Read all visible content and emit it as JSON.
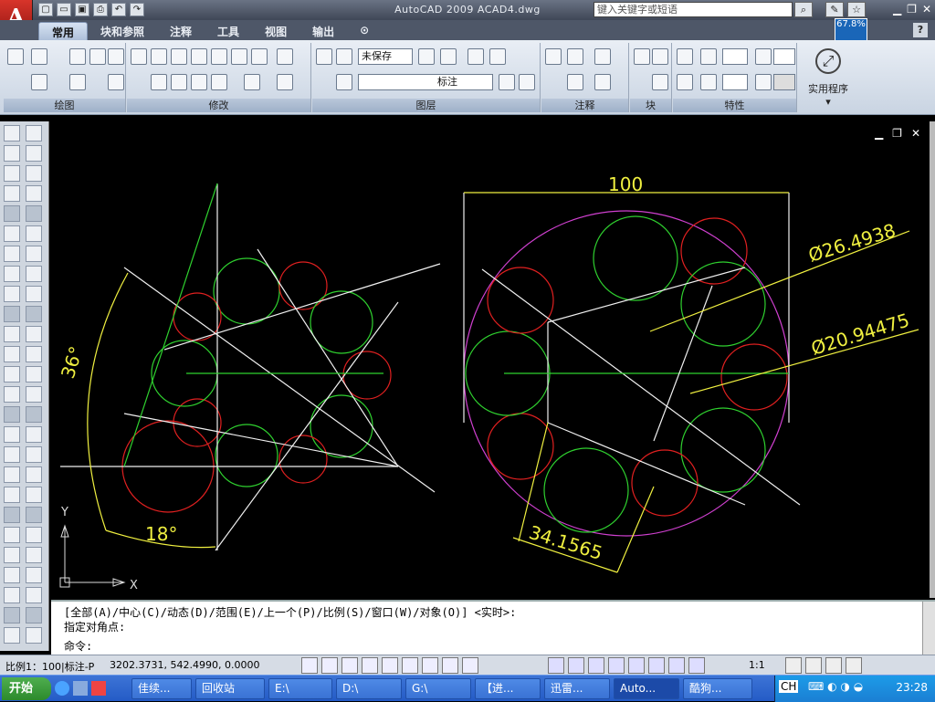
{
  "title": "AutoCAD 2009  ACAD4.dwg",
  "search_placeholder": "键入关键字或短语",
  "app_icon": "A",
  "zoom_badge": "67.8%",
  "qat_icons": [
    "new-icon",
    "open-icon",
    "save-icon",
    "print-icon",
    "undo-icon",
    "redo-icon"
  ],
  "tabs": [
    "常用",
    "块和参照",
    "注释",
    "工具",
    "视图",
    "输出"
  ],
  "panels": {
    "draw": "绘图",
    "modify": "修改",
    "layers": "图层",
    "annotation": "注释",
    "block": "块",
    "properties": "特性"
  },
  "layer_state": "未保存",
  "current_layer": "标注",
  "utility_label": "实用程序",
  "drawing": {
    "dim_100": "100",
    "dim_d1": "Ø26.4938",
    "dim_d2": "Ø20.94475",
    "dim_34": "34.1565",
    "angle_36": "36°",
    "angle_18": "18°",
    "ucs_x": "X",
    "ucs_y": "Y"
  },
  "command": {
    "line1": "[全部(A)/中心(C)/动态(D)/范围(E)/上一个(P)/比例(S)/窗口(W)/对象(O)] <实时>:",
    "line2": "指定对角点:",
    "prompt": "命令:"
  },
  "status": {
    "scale": "比例1：100|标注-P",
    "coords": "3202.3731, 542.4990, 0.0000",
    "annoscale": "1:1"
  },
  "taskbar": {
    "start": "开始",
    "items": [
      "佳续...",
      "回收站",
      "E:\\",
      "D:\\",
      "G:\\",
      "【进...",
      "迅雷...",
      "Auto...",
      "酷狗..."
    ],
    "lang": "CH",
    "clock": "23:28"
  },
  "colors": {
    "green": "#2fd12f",
    "red": "#e02020",
    "yellow": "#f0f040",
    "magenta": "#d040d0",
    "white": "#f0f0f0"
  }
}
